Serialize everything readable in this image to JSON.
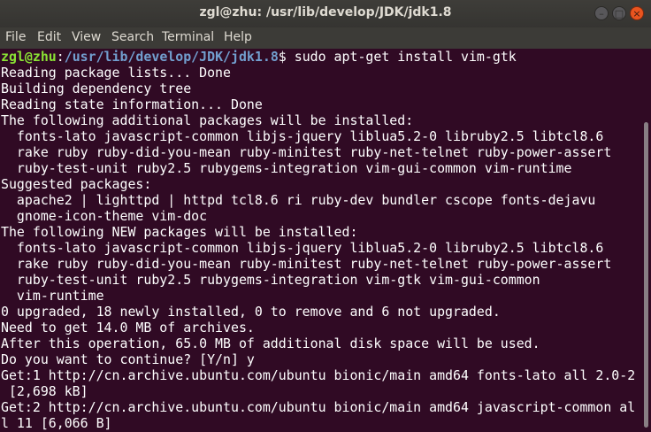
{
  "window": {
    "title": "zgl@zhu: /usr/lib/develop/JDK/jdk1.8",
    "minimize_glyph": "–",
    "maximize_glyph": "□",
    "close_glyph": "×"
  },
  "menubar": {
    "items": [
      "File",
      "Edit",
      "View",
      "Search",
      "Terminal",
      "Help"
    ]
  },
  "terminal": {
    "prompt": {
      "user_host": "zgl@zhu",
      "colon": ":",
      "path": "/usr/lib/develop/JDK/jdk1.8",
      "symbol": "$",
      "command": " sudo apt-get install vim-gtk"
    },
    "lines": [
      "Reading package lists... Done",
      "Building dependency tree",
      "Reading state information... Done",
      "The following additional packages will be installed:",
      "  fonts-lato javascript-common libjs-jquery liblua5.2-0 libruby2.5 libtcl8.6",
      "  rake ruby ruby-did-you-mean ruby-minitest ruby-net-telnet ruby-power-assert",
      "  ruby-test-unit ruby2.5 rubygems-integration vim-gui-common vim-runtime",
      "Suggested packages:",
      "  apache2 | lighttpd | httpd tcl8.6 ri ruby-dev bundler cscope fonts-dejavu",
      "  gnome-icon-theme vim-doc",
      "The following NEW packages will be installed:",
      "  fonts-lato javascript-common libjs-jquery liblua5.2-0 libruby2.5 libtcl8.6",
      "  rake ruby ruby-did-you-mean ruby-minitest ruby-net-telnet ruby-power-assert",
      "  ruby-test-unit ruby2.5 rubygems-integration vim-gtk vim-gui-common",
      "  vim-runtime",
      "0 upgraded, 18 newly installed, 0 to remove and 6 not upgraded.",
      "Need to get 14.0 MB of archives.",
      "After this operation, 65.0 MB of additional disk space will be used.",
      "Do you want to continue? [Y/n] y",
      "Get:1 http://cn.archive.ubuntu.com/ubuntu bionic/main amd64 fonts-lato all 2.0-2",
      " [2,698 kB]",
      "Get:2 http://cn.archive.ubuntu.com/ubuntu bionic/main amd64 javascript-common al",
      "l 11 [6,066 B]"
    ]
  },
  "colors": {
    "terminal_bg": "#300a24",
    "prompt_user": "#8ae234",
    "prompt_path": "#729fcf",
    "text": "#ffffff",
    "titlebar": "#3c3b37",
    "close_button": "#e9541f"
  }
}
